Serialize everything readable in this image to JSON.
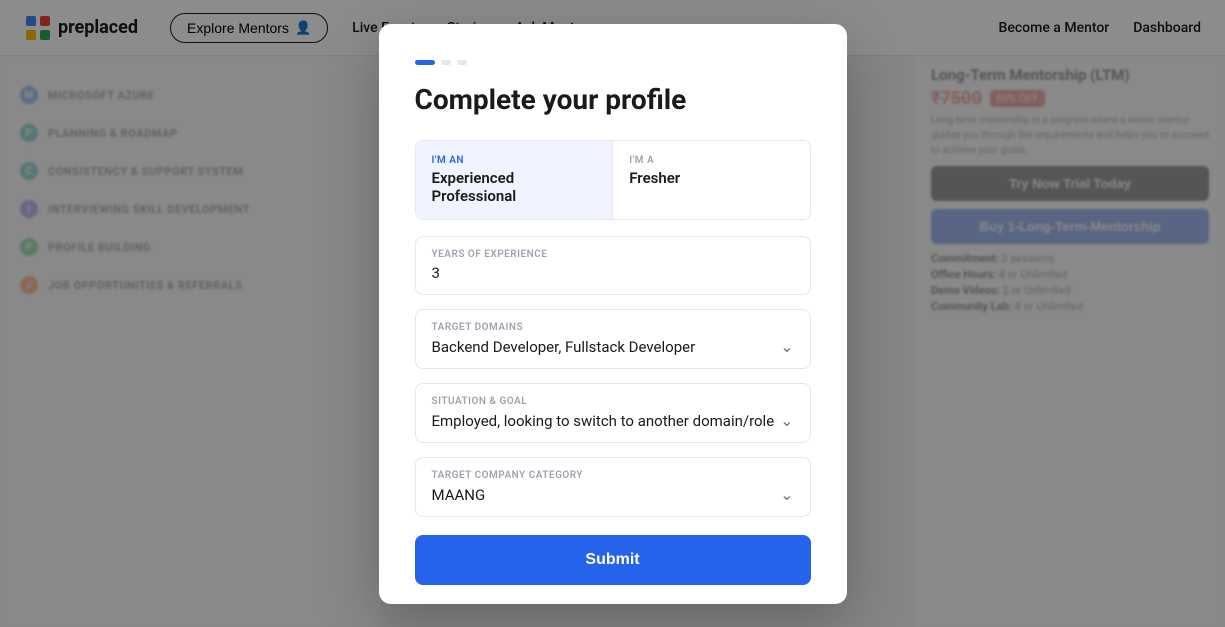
{
  "navbar": {
    "logo_text": "preplaced",
    "explore_btn": "Explore Mentors",
    "live_events": "Live Events",
    "stories": "Stories",
    "ask_mentors": "Ask Mentors",
    "become_mentor": "Become a Mentor",
    "dashboard": "Dashboard"
  },
  "bg_left": {
    "items": [
      {
        "label": "Microsoft Azure",
        "color": "blue"
      },
      {
        "label": "Planning & Roadmap",
        "color": "teal"
      },
      {
        "label": "Consistency & Support System",
        "color": "teal"
      },
      {
        "label": "Interviewing Skill Development",
        "color": "purple"
      },
      {
        "label": "Profile Building",
        "color": "green"
      },
      {
        "label": "Job Opportunities & Referrals",
        "color": "orange"
      }
    ]
  },
  "bg_right": {
    "title": "Long-Term Mentorship (LTM)",
    "price": "₹7500",
    "offer_badge": "60% OFF",
    "desc": "Long-term mentorship is a program where a senior mentor guides you through the requirements and helps you to succeed to achieve your goals.",
    "btn_trial": "Try Now Trial Today",
    "btn_buy": "Buy 1-Long-Term-Mentorship",
    "detail_1_label": "Commitment:",
    "detail_1_value": "3 sessions",
    "detail_2_label": "Office Hours:",
    "detail_2_value": "4 or Unlimited",
    "detail_3_label": "Demo Videos:",
    "detail_3_value": "2 or Unlimited",
    "detail_4_label": "Community Lab:",
    "detail_4_value": "4 or Unlimited"
  },
  "modal": {
    "title": "Complete your profile",
    "progress_dots": 3,
    "active_dot": 1,
    "role_option_1": {
      "label": "I'M AN",
      "value": "Experienced Professional",
      "active": true
    },
    "role_option_2": {
      "label": "I'M A",
      "value": "Fresher",
      "active": false
    },
    "years_label": "YEARS OF EXPERIENCE",
    "years_value": "3",
    "domains_label": "TARGET DOMAINS",
    "domains_value": "Backend Developer, Fullstack Developer",
    "situation_label": "SITUATION & GOAL",
    "situation_value": "Employed, looking to switch to another domain/role",
    "company_label": "TARGET COMPANY CATEGORY",
    "company_value": "MAANG",
    "submit_label": "Submit"
  }
}
